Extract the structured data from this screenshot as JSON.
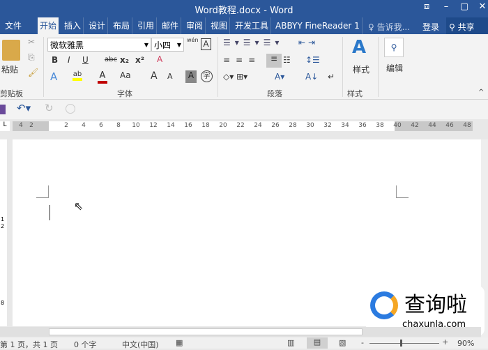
{
  "window": {
    "title": "Word教程.docx - Word"
  },
  "tabs": [
    {
      "label": "文件"
    },
    {
      "label": "开始"
    },
    {
      "label": "插入"
    },
    {
      "label": "设计"
    },
    {
      "label": "布局"
    },
    {
      "label": "引用"
    },
    {
      "label": "邮件"
    },
    {
      "label": "审阅"
    },
    {
      "label": "视图"
    },
    {
      "label": "开发工具"
    },
    {
      "label": "ABBYY FineReader 1"
    }
  ],
  "tell_me": "告诉我...",
  "login": "登录",
  "share": "共享",
  "ribbon": {
    "paste": "粘贴",
    "clipboard": "剪贴板",
    "font_name": "微软雅黑",
    "font_size": "小四",
    "font_group": "字体",
    "bold": "B",
    "italic": "I",
    "underline": "U",
    "strike": "abc",
    "sub": "x₂",
    "sup": "x²",
    "case": "Aa",
    "grow": "A",
    "shrink": "A",
    "pinyin": "wén",
    "paragraph_group": "段落",
    "styles": "样式",
    "styles_group": "样式",
    "editing": "编辑"
  },
  "ruler": {
    "left": [
      "4",
      "2"
    ],
    "right": [
      "2",
      "4",
      "6",
      "8",
      "10",
      "12",
      "14",
      "16",
      "18",
      "20",
      "22",
      "24",
      "26",
      "28",
      "30",
      "32",
      "34",
      "36",
      "38",
      "40",
      "42",
      "44",
      "46",
      "48"
    ]
  },
  "vruler": [
    "1",
    "2",
    "8"
  ],
  "status": {
    "page": "第 1 页，共 1 页",
    "words": "0 个字",
    "lang": "中文(中国)",
    "zoom": "90%"
  },
  "watermark": {
    "text": "查询啦",
    "domain": "chaxunla.com"
  },
  "colors": {
    "brand": "#2b579a",
    "highlight": "#ffff00",
    "font_color": "#c00000"
  }
}
